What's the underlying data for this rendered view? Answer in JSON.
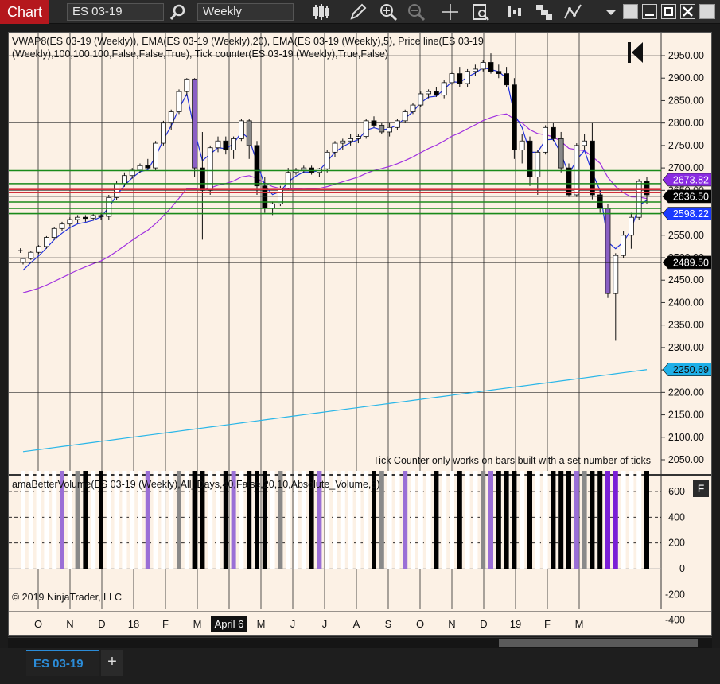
{
  "app": {
    "title": "Chart"
  },
  "toolbar": {
    "instrument": "ES 03-19",
    "interval": "Weekly"
  },
  "colors": {
    "background": "#fcf1e5",
    "up_candle": "#ffffff",
    "down_candle": "#000000",
    "vwap_line": "#1f2fdb",
    "ema20_line": "#a030e0",
    "ema5_line": "#29b6e8",
    "level_green": "#1a8a1a",
    "level_red": "#d1303a",
    "price_line": "#111111"
  },
  "price_pane": {
    "indicator_label": "VWAP8(ES 03-19 (Weekly)), EMA(ES 03-19 (Weekly),20), EMA(ES 03-19 (Weekly),5), Price line(ES 03-19 (Weekly),100,100,100,False,False,True), Tick counter(ES 03-19 (Weekly),True,False)",
    "tick_counter_message": "Tick Counter only works on bars built with a set number of ticks",
    "y_axis_ticks": [
      "2950.00",
      "2900.00",
      "2850.00",
      "2800.00",
      "2750.00",
      "2700.00",
      "2650.00",
      "2600.00",
      "2550.00",
      "2500.00",
      "2450.00",
      "2400.00",
      "2350.00",
      "2300.00",
      "2250.00",
      "2200.00",
      "2150.00",
      "2100.00",
      "2050.00"
    ],
    "price_labels": [
      {
        "text": "2673.82",
        "color": "#8a2be2"
      },
      {
        "text": "2636.50",
        "color": "#000000"
      },
      {
        "text": "2598.22",
        "color": "#1b3bff"
      },
      {
        "text": "2489.50",
        "color": "#000000"
      },
      {
        "text": "2250.69",
        "color": "#1fb0e8"
      }
    ]
  },
  "volume_pane": {
    "indicator_label": "amaBetterVolume(ES 03-19 (Weekly),All_Days,40,False,20,10,Absolute_Volume,8)",
    "y_axis_ticks": [
      "600",
      "400",
      "200",
      "0",
      "-200",
      "-400"
    ],
    "f_button": "F"
  },
  "x_axis": {
    "labels": [
      "O",
      "N",
      "D",
      "18",
      "F",
      "M",
      "April 6",
      "M",
      "J",
      "J",
      "A",
      "S",
      "O",
      "N",
      "D",
      "19",
      "F",
      "M"
    ],
    "highlighted": "April 6"
  },
  "copyright": "© 2019 NinjaTrader, LLC",
  "tabs": [
    {
      "label": "ES 03-19",
      "active": true
    }
  ],
  "add_tab_label": "+",
  "chart_data": {
    "type": "candlestick",
    "ylim": [
      2050,
      2975
    ],
    "candles": [
      [
        2490,
        2500,
        2485,
        2498
      ],
      [
        2498,
        2515,
        2495,
        2512
      ],
      [
        2512,
        2528,
        2508,
        2525
      ],
      [
        2525,
        2548,
        2520,
        2545
      ],
      [
        2545,
        2568,
        2540,
        2565
      ],
      [
        2565,
        2580,
        2560,
        2575
      ],
      [
        2575,
        2590,
        2570,
        2585
      ],
      [
        2585,
        2595,
        2578,
        2590
      ],
      [
        2590,
        2595,
        2580,
        2588
      ],
      [
        2588,
        2598,
        2583,
        2594
      ],
      [
        2594,
        2600,
        2585,
        2592
      ],
      [
        2592,
        2640,
        2585,
        2634
      ],
      [
        2634,
        2670,
        2628,
        2665
      ],
      [
        2665,
        2690,
        2658,
        2683
      ],
      [
        2683,
        2700,
        2676,
        2695
      ],
      [
        2695,
        2710,
        2688,
        2705
      ],
      [
        2705,
        2720,
        2698,
        2700
      ],
      [
        2700,
        2760,
        2695,
        2755
      ],
      [
        2755,
        2805,
        2750,
        2800
      ],
      [
        2800,
        2830,
        2785,
        2825
      ],
      [
        2825,
        2875,
        2820,
        2870
      ],
      [
        2870,
        2900,
        2860,
        2898
      ],
      [
        2898,
        2900,
        2680,
        2700
      ],
      [
        2700,
        2780,
        2540,
        2650
      ],
      [
        2650,
        2750,
        2640,
        2745
      ],
      [
        2745,
        2770,
        2735,
        2760
      ],
      [
        2760,
        2770,
        2730,
        2740
      ],
      [
        2740,
        2770,
        2720,
        2765
      ],
      [
        2765,
        2810,
        2760,
        2805
      ],
      [
        2805,
        2810,
        2720,
        2750
      ],
      [
        2750,
        2760,
        2640,
        2660
      ],
      [
        2660,
        2680,
        2600,
        2610
      ],
      [
        2610,
        2625,
        2595,
        2620
      ],
      [
        2620,
        2660,
        2615,
        2655
      ],
      [
        2655,
        2700,
        2650,
        2690
      ],
      [
        2690,
        2700,
        2685,
        2695
      ],
      [
        2695,
        2705,
        2688,
        2700
      ],
      [
        2700,
        2705,
        2685,
        2690
      ],
      [
        2690,
        2700,
        2680,
        2698
      ],
      [
        2698,
        2740,
        2690,
        2735
      ],
      [
        2735,
        2760,
        2725,
        2755
      ],
      [
        2755,
        2765,
        2740,
        2760
      ],
      [
        2760,
        2775,
        2750,
        2765
      ],
      [
        2765,
        2775,
        2755,
        2770
      ],
      [
        2770,
        2810,
        2765,
        2805
      ],
      [
        2805,
        2815,
        2790,
        2795
      ],
      [
        2795,
        2800,
        2775,
        2780
      ],
      [
        2780,
        2800,
        2770,
        2790
      ],
      [
        2790,
        2810,
        2785,
        2805
      ],
      [
        2805,
        2830,
        2800,
        2825
      ],
      [
        2825,
        2845,
        2820,
        2840
      ],
      [
        2840,
        2870,
        2835,
        2865
      ],
      [
        2865,
        2875,
        2855,
        2870
      ],
      [
        2870,
        2880,
        2858,
        2862
      ],
      [
        2862,
        2895,
        2855,
        2890
      ],
      [
        2890,
        2915,
        2885,
        2910
      ],
      [
        2910,
        2925,
        2880,
        2888
      ],
      [
        2888,
        2920,
        2880,
        2915
      ],
      [
        2915,
        2930,
        2905,
        2920
      ],
      [
        2920,
        2940,
        2915,
        2935
      ],
      [
        2935,
        2955,
        2910,
        2915
      ],
      [
        2915,
        2930,
        2900,
        2910
      ],
      [
        2910,
        2925,
        2880,
        2885
      ],
      [
        2885,
        2900,
        2720,
        2740
      ],
      [
        2740,
        2775,
        2710,
        2760
      ],
      [
        2760,
        2770,
        2660,
        2680
      ],
      [
        2680,
        2740,
        2640,
        2735
      ],
      [
        2735,
        2795,
        2730,
        2790
      ],
      [
        2790,
        2800,
        2760,
        2765
      ],
      [
        2765,
        2780,
        2690,
        2700
      ],
      [
        2700,
        2710,
        2635,
        2640
      ],
      [
        2640,
        2755,
        2635,
        2750
      ],
      [
        2750,
        2775,
        2740,
        2760
      ],
      [
        2760,
        2800,
        2630,
        2640
      ],
      [
        2640,
        2650,
        2600,
        2610
      ],
      [
        2610,
        2620,
        2410,
        2420
      ],
      [
        2420,
        2510,
        2315,
        2505
      ],
      [
        2505,
        2560,
        2500,
        2550
      ],
      [
        2550,
        2600,
        2520,
        2590
      ],
      [
        2590,
        2675,
        2585,
        2670
      ],
      [
        2670,
        2680,
        2620,
        2640
      ]
    ],
    "levels": [
      {
        "price": 2694,
        "color": "green"
      },
      {
        "price": 2665,
        "color": "green"
      },
      {
        "price": 2652,
        "color": "red"
      },
      {
        "price": 2645,
        "color": "red"
      },
      {
        "price": 2624,
        "color": "green"
      },
      {
        "price": 2610,
        "color": "green"
      },
      {
        "price": 2598.22,
        "color": "green"
      }
    ]
  }
}
